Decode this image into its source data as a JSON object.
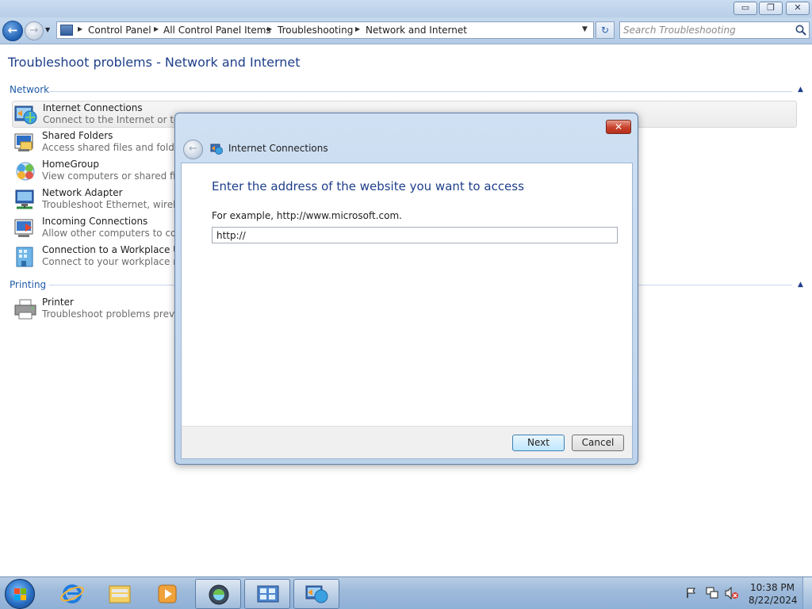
{
  "window": {
    "caption_buttons": {
      "minimize": "▭",
      "maximize": "❐",
      "close": "✕"
    }
  },
  "nav": {
    "back_glyph": "←",
    "forward_glyph": "→",
    "recent_glyph": "▼",
    "breadcrumbs": [
      "Control Panel",
      "All Control Panel Items",
      "Troubleshooting",
      "Network and Internet"
    ],
    "crumb_separator": "▶",
    "address_dropdown_glyph": "▼",
    "refresh_glyph": "↻",
    "search_placeholder": "Search Troubleshooting"
  },
  "content": {
    "page_title": "Troubleshoot problems - Network and Internet",
    "sections": [
      {
        "header": "Network",
        "items": [
          {
            "title": "Internet Connections",
            "description": "Connect to the Internet or to a p",
            "icon": "internet-connections-icon",
            "selected": true
          },
          {
            "title": "Shared Folders",
            "description": "Access shared files and folders o",
            "icon": "shared-folders-icon",
            "selected": false
          },
          {
            "title": "HomeGroup",
            "description": "View computers or shared files i",
            "icon": "homegroup-icon",
            "selected": false
          },
          {
            "title": "Network Adapter",
            "description": "Troubleshoot Ethernet, wireless,",
            "icon": "network-adapter-icon",
            "selected": false
          },
          {
            "title": "Incoming Connections",
            "description": "Allow other computers to comm",
            "icon": "incoming-connections-icon",
            "selected": false
          },
          {
            "title": "Connection to a Workplace Usin",
            "description": "Connect to your workplace netw",
            "icon": "workplace-connection-icon",
            "selected": false
          }
        ]
      },
      {
        "header": "Printing",
        "items": [
          {
            "title": "Printer",
            "description": "Troubleshoot problems prevent",
            "icon": "printer-icon",
            "selected": false
          }
        ]
      }
    ],
    "collapse_glyph": "▲"
  },
  "dialog": {
    "title": "Internet Connections",
    "close_glyph": "✕",
    "back_glyph": "←",
    "heading": "Enter the address of the website you want to access",
    "example_text": "For example, http://www.microsoft.com.",
    "url_value": "http://",
    "next_label": "Next",
    "cancel_label": "Cancel"
  },
  "taskbar": {
    "pinned": [
      {
        "name": "internet-explorer",
        "active": false
      },
      {
        "name": "windows-explorer",
        "active": false
      },
      {
        "name": "media-player",
        "active": false
      },
      {
        "name": "orb-app",
        "active": true
      },
      {
        "name": "control-panel",
        "active": true
      },
      {
        "name": "troubleshooter",
        "active": true
      }
    ],
    "clock_time": "10:38 PM",
    "clock_date": "8/22/2024"
  },
  "colors": {
    "link_blue": "#1e3f8a",
    "section_blue": "#1e5aa8",
    "dialog_frame": "#bdd3ec",
    "close_red": "#c8412c"
  }
}
